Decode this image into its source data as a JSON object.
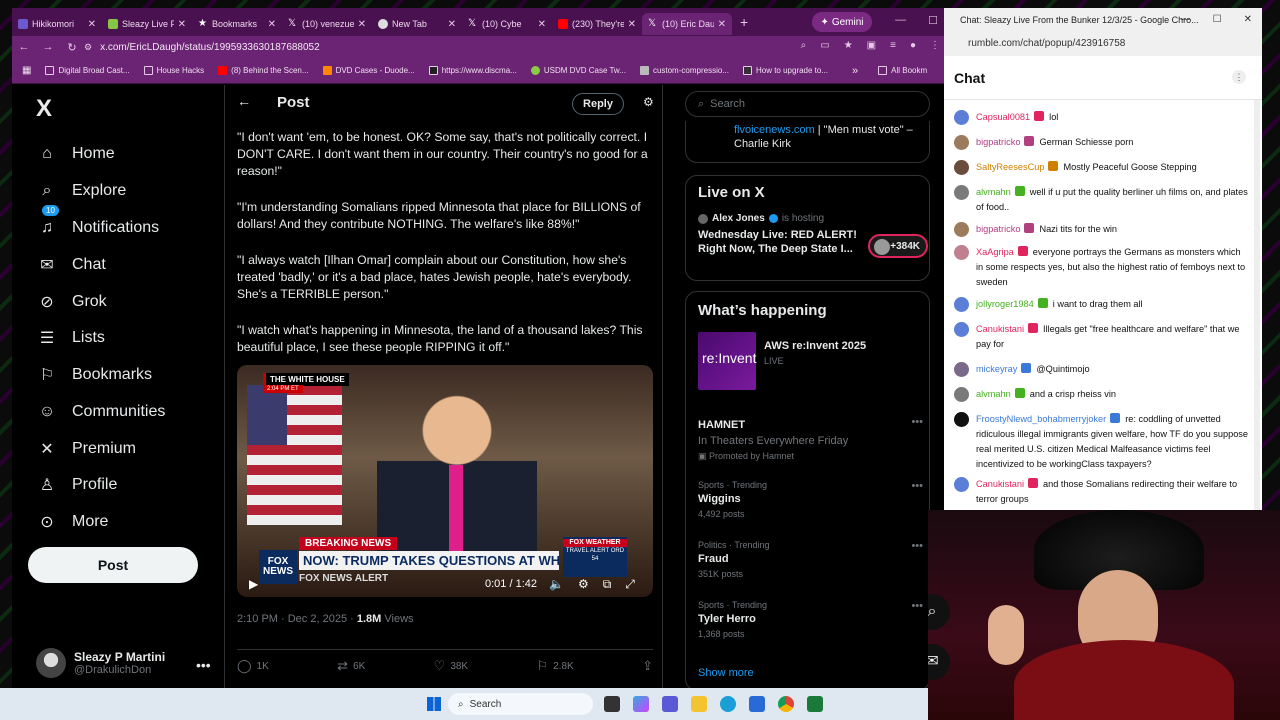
{
  "tabs": [
    {
      "label": "Hikikomori",
      "color": "#6a5acd"
    },
    {
      "label": "Sleazy Live F",
      "color": "#85c742"
    },
    {
      "label": "Bookmarks",
      "color": "#ffffff"
    },
    {
      "label": "(10) venezue",
      "color": "#000000"
    },
    {
      "label": "New Tab",
      "color": "#dddddd"
    },
    {
      "label": "(10) Cybe",
      "color": "#000000"
    },
    {
      "label": "(230) They're",
      "color": "#ff0000"
    },
    {
      "label": "(10) Eric Dau",
      "color": "#000000"
    }
  ],
  "new_tab_symbol": "+",
  "gemini_label": "Gemini",
  "url": "x.com/EricLDaugh/status/1995933630187688052",
  "bookmarks": [
    "Digital Broad Cast...",
    "House Hacks",
    "(8) Behind the Scen...",
    "DVD Cases - Duode...",
    "https://www.discma...",
    "USDM DVD Case Tw...",
    "custom-compressio...",
    "How to upgrade to..."
  ],
  "bookmarks_more": "»",
  "all_bookmarks": "All Bookm",
  "x_logo": "X",
  "nav": {
    "home": "Home",
    "explore": "Explore",
    "notifications": "Notifications",
    "notifications_badge": "10",
    "chat": "Chat",
    "grok": "Grok",
    "lists": "Lists",
    "bookmarks": "Bookmarks",
    "communities": "Communities",
    "premium": "Premium",
    "profile": "Profile",
    "more": "More",
    "post_button": "Post"
  },
  "account": {
    "name": "Sleazy P Martini",
    "handle": "@DrakulichDon"
  },
  "post": {
    "header": "Post",
    "reply": "Reply",
    "paragraphs": [
      "\"I don't want 'em, to be honest. OK? Some say, that's not politically correct. I DON'T CARE. I don't want them in our country. Their country's no good for a reason!\"",
      "\"I'm understanding Somalians ripped Minnesota that place for BILLIONS of dollars! And they contribute NOTHING. The welfare's like 88%!\"",
      "\"I always watch [Ilhan Omar] complain about our Constitution, how she's treated 'badly,' or it's a bad place, hates Jewish people, hate's everybody. She's a TERRIBLE person.\"",
      "\"I watch what's happening in Minnesota, the land of a thousand lakes? This beautiful place, I see these people RIPPING it off.\""
    ],
    "video": {
      "wh_tag": "THE WHITE HOUSE",
      "wh_time": "2:04 PM ET",
      "fox_logo": "FOX NEWS",
      "breaking": "BREAKING NEWS",
      "headline": "NOW: TRUMP TAKES QUESTIONS AT WHITE HOUSE",
      "fox_alert": "FOX NEWS ALERT",
      "weather_head": "FOX WEATHER",
      "weather_body": "TRAVEL ALERT ORD 54",
      "time": "0:01 / 1:42"
    },
    "meta_date": "2:10 PM · Dec 2, 2025 · ",
    "meta_views_count": "1.8M",
    "meta_views_label": " Views",
    "replies": "1K",
    "reposts": "6K",
    "likes": "38K",
    "bookmarks": "2.8K"
  },
  "right": {
    "search_placeholder": "Search",
    "news_link": "flvoicenews.com",
    "news_text": " | \"Men must vote\" – Charlie Kirk",
    "live_title": "Live on X",
    "live_host": "Alex Jones",
    "live_hosting": "is hosting",
    "live_event": "Wednesday Live: RED ALERT! Right Now, The Deep State I...",
    "live_count": "+384K",
    "happening_title": "What’s happening",
    "aws_img_text": "re:Invent",
    "aws_title": "AWS re:Invent 2025",
    "aws_live": "LIVE",
    "trends": [
      {
        "cat": "",
        "name": "HAMNET",
        "sub": "In Theaters Everywhere Friday",
        "posts": "Promoted by Hamnet"
      },
      {
        "cat": "Sports · Trending",
        "name": "Wiggins",
        "sub": "",
        "posts": "4,492 posts"
      },
      {
        "cat": "Politics · Trending",
        "name": "Fraud",
        "sub": "",
        "posts": "351K posts"
      },
      {
        "cat": "Sports · Trending",
        "name": "Tyler Herro",
        "sub": "",
        "posts": "1,368 posts"
      }
    ],
    "show_more": "Show more"
  },
  "taskbar": {
    "search": "Search"
  },
  "chat": {
    "window_title": "Chat: Sleazy Live From the Bunker 12/3/25 - Google Chro...",
    "url": "rumble.com/chat/popup/423916758",
    "title": "Chat",
    "messages": [
      {
        "user": "Capsual0081",
        "text": "lol",
        "ucolor": "#e0245e",
        "av": "#5b7fd6"
      },
      {
        "user": "bigpatricko",
        "text": "German Schiesse porn",
        "ucolor": "#b04080",
        "av": "#9b7b5b"
      },
      {
        "user": "SaltyReesesCup",
        "text": "Mostly Peaceful Goose Stepping",
        "ucolor": "#d08000",
        "av": "#6b4b3b"
      },
      {
        "user": "alvmahn",
        "text": "well if u put the quality berliner uh films on, and plates of food..",
        "ucolor": "#45b020",
        "av": "#7a7a7a"
      },
      {
        "user": "bigpatricko",
        "text": "Nazi tits for the win",
        "ucolor": "#b04080",
        "av": "#9b7b5b"
      },
      {
        "user": "XaAgripa",
        "text": "everyone portrays the Germans as monsters which in some respects yes, but also the highest ratio of femboys next to sweden",
        "ucolor": "#e0245e",
        "av": "#c08090"
      },
      {
        "user": "jollyroger1984",
        "text": "i want to drag them all",
        "ucolor": "#45b020",
        "av": "#5b7fd6"
      },
      {
        "user": "Canukistani",
        "text": "Illegals get \"free healthcare and welfare\" that we pay for",
        "ucolor": "#e0245e",
        "av": "#5b7fd6"
      },
      {
        "user": "mickeyray",
        "text": "@Quintimojo",
        "ucolor": "#3a7ad6",
        "av": "#7a6a8a"
      },
      {
        "user": "alvmahn",
        "text": "and a crisp rheiss vin",
        "ucolor": "#45b020",
        "av": "#7a7a7a"
      },
      {
        "user": "FroostyNlewd_bohabmerryjoker",
        "text": "re: coddling of unvetted ridiculous illegal immigrants given welfare, how TF do you suppose real merited U.S. citizen Medical Malfeasance victims feel incentivized to be workingClass taxpayers?",
        "ucolor": "#3a7ad6",
        "av": "#111111"
      },
      {
        "user": "Canukistani",
        "text": "and those Somalians redirecting their welfare to terror groups",
        "ucolor": "#e0245e",
        "av": "#5b7fd6"
      }
    ]
  }
}
